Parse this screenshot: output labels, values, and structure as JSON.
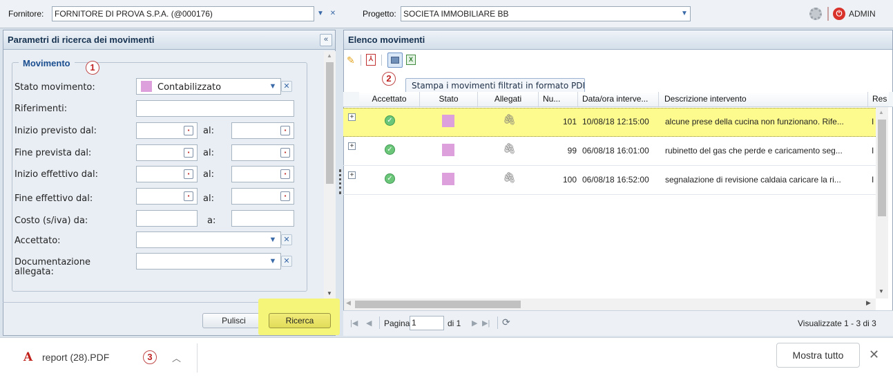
{
  "topbar": {
    "fornitore_label": "Fornitore:",
    "fornitore_value": "FORNITORE DI PROVA S.P.A. (@000176)",
    "progetto_label": "Progetto:",
    "progetto_value": "SOCIETA IMMOBILIARE BB",
    "user": "ADMIN"
  },
  "left_panel": {
    "title": "Parametri di ricerca dei movimenti",
    "section": "Movimento",
    "fields": {
      "stato": "Stato movimento:",
      "stato_value": "Contabilizzato",
      "riferimenti": "Riferimenti:",
      "inizio_previsto": "Inizio previsto dal:",
      "fine_prevista": "Fine prevista dal:",
      "inizio_effettivo": "Inizio effettivo dal:",
      "fine_effettivo": "Fine effettivo dal:",
      "costo": "Costo (s/iva) da:",
      "accettato": "Accettato:",
      "documentazione_1": "Documentazione",
      "documentazione_2": "allegata:",
      "al": "al:",
      "a": "a:"
    },
    "buttons": {
      "pulisci": "Pulisci",
      "ricerca": "Ricerca"
    }
  },
  "right_panel": {
    "title": "Elenco movimenti",
    "tooltip": "Stampa i movimenti filtrati in formato PDF",
    "columns": [
      "Accettato",
      "Stato",
      "Allegati",
      "Nu...",
      "Data/ora interve...",
      "Descrizione intervento",
      "Res"
    ],
    "rows": [
      {
        "num": "101",
        "datetime": "10/08/18 12:15:00",
        "desc": "alcune prese della cucina non funzionano. Rife...",
        "res": "I"
      },
      {
        "num": "99",
        "datetime": "06/08/18 16:01:00",
        "desc": "rubinetto del gas che perde e caricamento seg...",
        "res": "I"
      },
      {
        "num": "100",
        "datetime": "06/08/18 16:52:00",
        "desc": "segnalazione di revisione caldaia caricare la ri...",
        "res": "I"
      }
    ],
    "paging": {
      "pagina": "Pagina",
      "page_value": "1",
      "di": "di 1",
      "summary": "Visualizzate 1 - 3 di 3"
    }
  },
  "annotations": [
    "1",
    "2",
    "3"
  ],
  "download_bar": {
    "file": "report (28).PDF",
    "mostra_tutto": "Mostra tutto",
    "status_color": "#dda0dd"
  }
}
